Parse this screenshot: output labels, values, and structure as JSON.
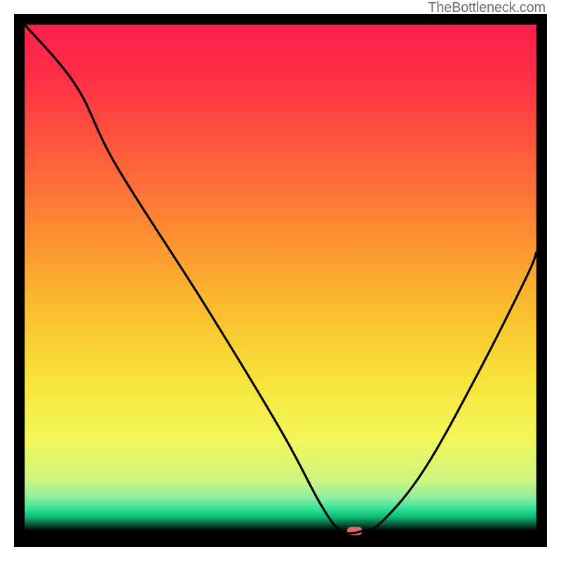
{
  "watermark": "TheBottleneck.com",
  "chart_data": {
    "type": "line",
    "title": "",
    "xlabel": "",
    "ylabel": "",
    "xlim": [
      0,
      100
    ],
    "ylim": [
      0,
      100
    ],
    "grid": false,
    "legend": false,
    "series": [
      {
        "name": "bottleneck-curve",
        "color": "#000000",
        "x": [
          0,
          10,
          18,
          35,
          50,
          58,
          62,
          66,
          70,
          78,
          88,
          98,
          100
        ],
        "y": [
          100,
          88,
          72,
          45,
          20,
          5,
          0,
          0,
          2,
          12,
          30,
          50,
          55
        ]
      }
    ],
    "marker": {
      "x": 64.5,
      "y": 0,
      "color": "#d96a64",
      "width_pct": 3
    },
    "gradient_stops": [
      {
        "offset": 0.0,
        "color": "#ff1f4b"
      },
      {
        "offset": 0.1,
        "color": "#ff2e46"
      },
      {
        "offset": 0.25,
        "color": "#fe5b3c"
      },
      {
        "offset": 0.4,
        "color": "#fe8a33"
      },
      {
        "offset": 0.55,
        "color": "#fbba2e"
      },
      {
        "offset": 0.7,
        "color": "#f7e33a"
      },
      {
        "offset": 0.82,
        "color": "#f3f75a"
      },
      {
        "offset": 0.9,
        "color": "#cff480"
      },
      {
        "offset": 0.935,
        "color": "#8beea0"
      },
      {
        "offset": 0.955,
        "color": "#3ae29a"
      },
      {
        "offset": 0.965,
        "color": "#17cf86"
      },
      {
        "offset": 0.972,
        "color": "#0fbd77"
      },
      {
        "offset": 1.0,
        "color": "#000000"
      }
    ],
    "inner_box": {
      "x": 2,
      "y": 2,
      "w": 96,
      "h": 95
    }
  }
}
